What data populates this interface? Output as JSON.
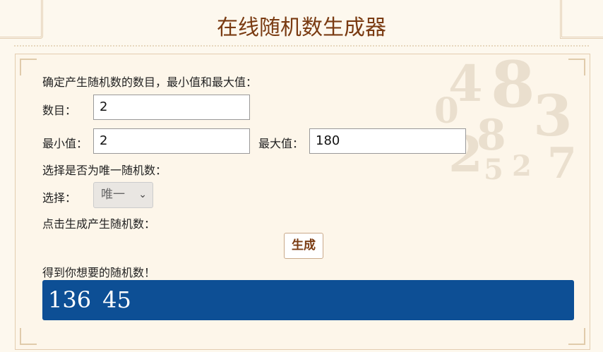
{
  "title": "在线随机数生成器",
  "intro": "确定产生随机数的数目，最小值和最大值：",
  "count": {
    "label": "数目：",
    "value": "2"
  },
  "min": {
    "label": "最小值：",
    "value": "2"
  },
  "max": {
    "label": "最大值：",
    "value": "180"
  },
  "unique_prompt": "选择是否为唯一随机数：",
  "choice": {
    "label": "选择：",
    "selected": "唯一"
  },
  "generate_prompt": "点击生成产生随机数：",
  "generate_button": "生成",
  "result_label": "得到你想要的随机数！",
  "results": [
    "136",
    "45"
  ]
}
